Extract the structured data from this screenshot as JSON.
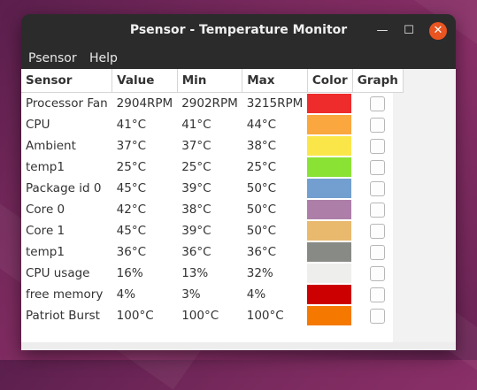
{
  "window": {
    "title": "Psensor - Temperature Monitor",
    "minimize_glyph": "—",
    "maximize_glyph": "☐",
    "close_glyph": "✕"
  },
  "menu": {
    "items": [
      "Psensor",
      "Help"
    ]
  },
  "table": {
    "headers": {
      "sensor": "Sensor",
      "value": "Value",
      "min": "Min",
      "max": "Max",
      "color": "Color",
      "graph": "Graph"
    },
    "rows": [
      {
        "name": "Processor Fan",
        "value": "2904RPM",
        "min": "2902RPM",
        "max": "3215RPM",
        "color": "#ee2c2c"
      },
      {
        "name": "CPU",
        "value": "41°C",
        "min": "41°C",
        "max": "44°C",
        "color": "#f9a73e"
      },
      {
        "name": "Ambient",
        "value": "37°C",
        "min": "37°C",
        "max": "38°C",
        "color": "#fbe64a"
      },
      {
        "name": "temp1",
        "value": "25°C",
        "min": "25°C",
        "max": "25°C",
        "color": "#8ae234"
      },
      {
        "name": "Package id 0",
        "value": "45°C",
        "min": "39°C",
        "max": "50°C",
        "color": "#729fcf"
      },
      {
        "name": "Core 0",
        "value": "42°C",
        "min": "38°C",
        "max": "50°C",
        "color": "#ad7fa8"
      },
      {
        "name": "Core 1",
        "value": "45°C",
        "min": "39°C",
        "max": "50°C",
        "color": "#e9b96e"
      },
      {
        "name": "temp1",
        "value": "36°C",
        "min": "36°C",
        "max": "36°C",
        "color": "#888a85"
      },
      {
        "name": "CPU usage",
        "value": "16%",
        "min": "13%",
        "max": "32%",
        "color": "#eeeeec"
      },
      {
        "name": "free memory",
        "value": "4%",
        "min": "3%",
        "max": "4%",
        "color": "#cc0000"
      },
      {
        "name": "Patriot Burst",
        "value": "100°C",
        "min": "100°C",
        "max": "100°C",
        "color": "#f57900"
      }
    ]
  }
}
